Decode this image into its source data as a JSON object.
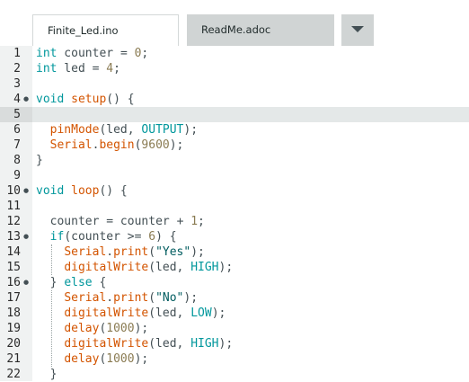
{
  "tabs": [
    {
      "label": "Finite_Led.ino",
      "active": true
    },
    {
      "label": "ReadMe.adoc",
      "active": false
    }
  ],
  "tab_menu_icon": "chevron-down-icon",
  "editor": {
    "current_line": 5,
    "folded_lines": [
      4,
      10,
      13,
      16
    ],
    "lines": [
      {
        "n": "1",
        "tokens": [
          [
            "kw",
            "int"
          ],
          [
            "t",
            " counter "
          ],
          [
            "op",
            "="
          ],
          [
            "t",
            " "
          ],
          [
            "num",
            "0"
          ],
          [
            "t",
            ";"
          ]
        ]
      },
      {
        "n": "2",
        "tokens": [
          [
            "kw",
            "int"
          ],
          [
            "t",
            " led "
          ],
          [
            "op",
            "="
          ],
          [
            "t",
            " "
          ],
          [
            "num",
            "4"
          ],
          [
            "t",
            ";"
          ]
        ]
      },
      {
        "n": "3",
        "tokens": []
      },
      {
        "n": "4",
        "tokens": [
          [
            "kw",
            "void"
          ],
          [
            "t",
            " "
          ],
          [
            "fn",
            "setup"
          ],
          [
            "t",
            "() {"
          ]
        ]
      },
      {
        "n": "5",
        "tokens": []
      },
      {
        "n": "6",
        "tokens": [
          [
            "t",
            "  "
          ],
          [
            "fn",
            "pinMode"
          ],
          [
            "t",
            "(led, "
          ],
          [
            "const",
            "OUTPUT"
          ],
          [
            "t",
            ");"
          ]
        ]
      },
      {
        "n": "7",
        "tokens": [
          [
            "t",
            "  "
          ],
          [
            "fn",
            "Serial"
          ],
          [
            "t",
            "."
          ],
          [
            "fn",
            "begin"
          ],
          [
            "t",
            "("
          ],
          [
            "num",
            "9600"
          ],
          [
            "t",
            ");"
          ]
        ]
      },
      {
        "n": "8",
        "tokens": [
          [
            "t",
            "}"
          ]
        ]
      },
      {
        "n": "9",
        "tokens": []
      },
      {
        "n": "10",
        "tokens": [
          [
            "kw",
            "void"
          ],
          [
            "t",
            " "
          ],
          [
            "fn",
            "loop"
          ],
          [
            "t",
            "() {"
          ]
        ]
      },
      {
        "n": "11",
        "tokens": []
      },
      {
        "n": "12",
        "tokens": [
          [
            "t",
            "  counter "
          ],
          [
            "op",
            "="
          ],
          [
            "t",
            " counter "
          ],
          [
            "op",
            "+"
          ],
          [
            "t",
            " "
          ],
          [
            "num",
            "1"
          ],
          [
            "t",
            ";"
          ]
        ]
      },
      {
        "n": "13",
        "tokens": [
          [
            "t",
            "  "
          ],
          [
            "kw",
            "if"
          ],
          [
            "t",
            "(counter "
          ],
          [
            "op",
            ">="
          ],
          [
            "t",
            " "
          ],
          [
            "num",
            "6"
          ],
          [
            "t",
            ") {"
          ]
        ]
      },
      {
        "n": "14",
        "tokens": [
          [
            "t",
            "    "
          ],
          [
            "fn",
            "Serial"
          ],
          [
            "t",
            "."
          ],
          [
            "fn",
            "print"
          ],
          [
            "t",
            "("
          ],
          [
            "str",
            "\"Yes\""
          ],
          [
            "t",
            ");"
          ]
        ]
      },
      {
        "n": "15",
        "tokens": [
          [
            "t",
            "    "
          ],
          [
            "fn",
            "digitalWrite"
          ],
          [
            "t",
            "(led, "
          ],
          [
            "const",
            "HIGH"
          ],
          [
            "t",
            ");"
          ]
        ]
      },
      {
        "n": "16",
        "tokens": [
          [
            "t",
            "  } "
          ],
          [
            "kw",
            "else"
          ],
          [
            "t",
            " {"
          ]
        ]
      },
      {
        "n": "17",
        "tokens": [
          [
            "t",
            "    "
          ],
          [
            "fn",
            "Serial"
          ],
          [
            "t",
            "."
          ],
          [
            "fn",
            "print"
          ],
          [
            "t",
            "("
          ],
          [
            "str",
            "\"No\""
          ],
          [
            "t",
            ");"
          ]
        ]
      },
      {
        "n": "18",
        "tokens": [
          [
            "t",
            "    "
          ],
          [
            "fn",
            "digitalWrite"
          ],
          [
            "t",
            "(led, "
          ],
          [
            "const",
            "LOW"
          ],
          [
            "t",
            ");"
          ]
        ]
      },
      {
        "n": "19",
        "tokens": [
          [
            "t",
            "    "
          ],
          [
            "fn",
            "delay"
          ],
          [
            "t",
            "("
          ],
          [
            "num",
            "1000"
          ],
          [
            "t",
            ");"
          ]
        ]
      },
      {
        "n": "20",
        "tokens": [
          [
            "t",
            "    "
          ],
          [
            "fn",
            "digitalWrite"
          ],
          [
            "t",
            "(led, "
          ],
          [
            "const",
            "HIGH"
          ],
          [
            "t",
            ");"
          ]
        ]
      },
      {
        "n": "21",
        "tokens": [
          [
            "t",
            "    "
          ],
          [
            "fn",
            "delay"
          ],
          [
            "t",
            "("
          ],
          [
            "num",
            "1000"
          ],
          [
            "t",
            ");"
          ]
        ]
      },
      {
        "n": "22",
        "tokens": [
          [
            "t",
            "  }"
          ]
        ]
      }
    ]
  },
  "colors": {
    "keyword": "#00979c",
    "function": "#d35400",
    "number": "#8a7b52",
    "string": "#005c5f",
    "text": "#434f54",
    "current_line": "#e4e8e8",
    "tab_inactive": "#d0d4d4"
  }
}
